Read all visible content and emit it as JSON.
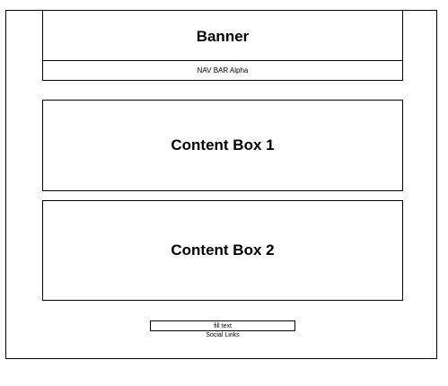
{
  "banner": {
    "title": "Banner"
  },
  "nav": {
    "label": "NAV BAR Alpha"
  },
  "content": {
    "box1": "Content Box 1",
    "box2": "Content Box 2"
  },
  "footer": {
    "fill_text": "fill text",
    "social_links": "Social Links"
  }
}
